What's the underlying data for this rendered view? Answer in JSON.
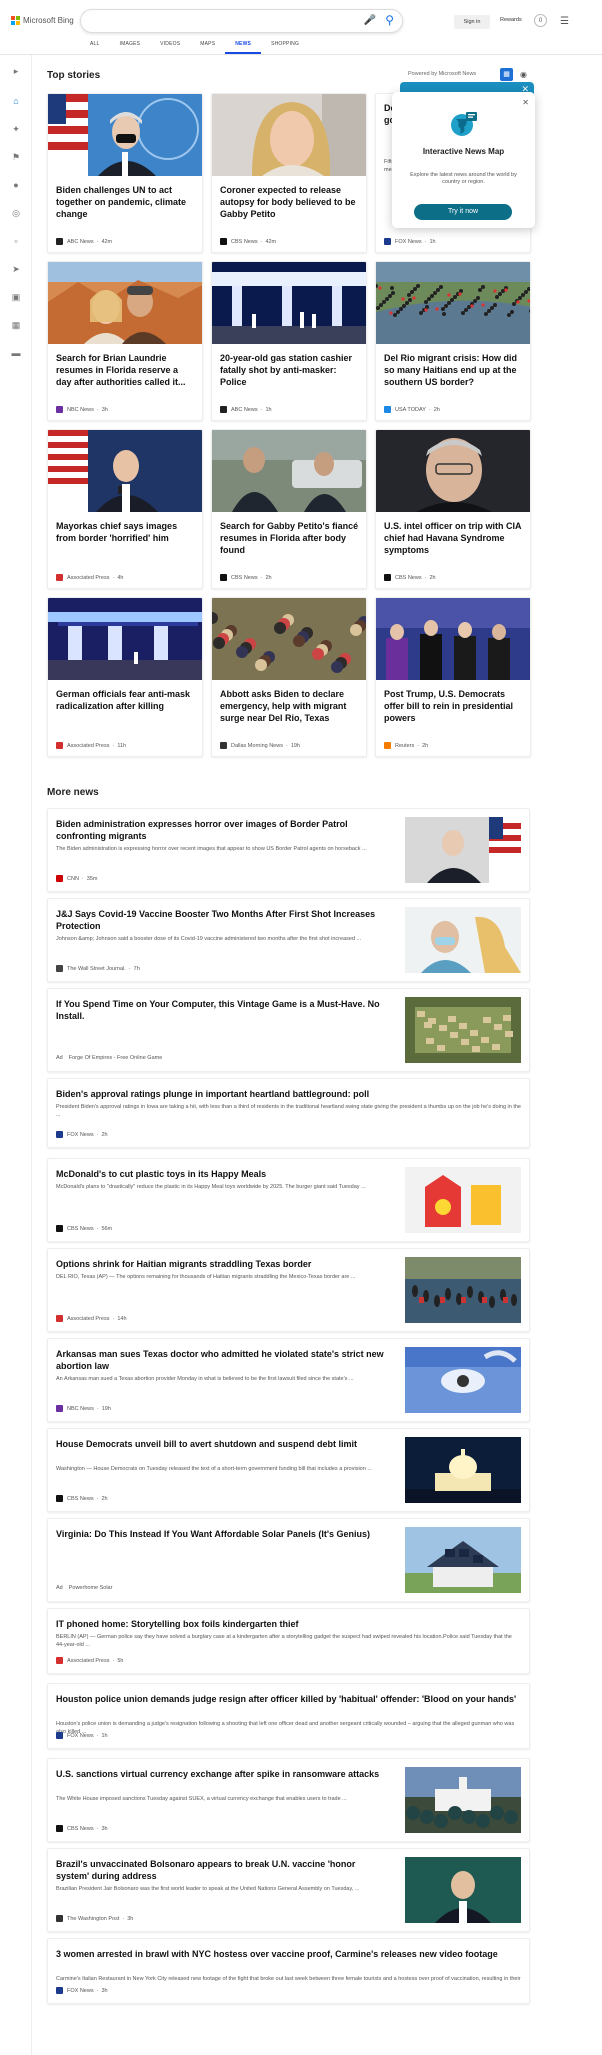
{
  "header": {
    "logo_text": "Microsoft Bing",
    "signin": "Sign in",
    "rewards": "Rewards",
    "rewards_count": "0",
    "tabs": [
      "ALL",
      "IMAGES",
      "VIDEOS",
      "MAPS",
      "NEWS",
      "SHOPPING"
    ],
    "active_tab": "NEWS"
  },
  "top_stories": {
    "title": "Top stories",
    "powered_by": "Powered by Microsoft News",
    "cards": [
      {
        "title": "Biden challenges UN to act together on pandemic, climate change",
        "source": "ABC News",
        "time": "42m",
        "source_color": "#222"
      },
      {
        "title": "Coroner expected to release autopsy for body believed to be Gabby Petito",
        "source": "CBS News",
        "time": "42m",
        "source_color": "#111"
      },
      {
        "title": "Democrats unveil bill to fund government, raise debt limit",
        "source": "FOX News",
        "time": "1h",
        "source_color": "#1b3b8c",
        "desc": "Fifteen House Democrats are circulating a stopgap measure and Biden ... that they ... and the ..."
      },
      {
        "title": "Search for Brian Laundrie resumes in Florida reserve a day after authorities called it...",
        "source": "NBC News",
        "time": "3h",
        "source_color": "#6b2fa0"
      },
      {
        "title": "20-year-old gas station cashier fatally shot by anti-masker: Police",
        "source": "ABC News",
        "time": "1h",
        "source_color": "#222"
      },
      {
        "title": "Del Rio migrant crisis: How did so many Haitians end up at the southern US border?",
        "source": "USA TODAY",
        "time": "2h",
        "source_color": "#1e88e5"
      },
      {
        "title": "Mayorkas chief says images from border 'horrified' him",
        "source": "Associated Press",
        "time": "4h",
        "source_color": "#d32f2f"
      },
      {
        "title": "Search for Gabby Petito's fiancé resumes in Florida after body found",
        "source": "CBS News",
        "time": "2h",
        "source_color": "#111"
      },
      {
        "title": "U.S. intel officer on trip with CIA chief had Havana Syndrome symptoms",
        "source": "CBS News",
        "time": "2h",
        "source_color": "#111"
      },
      {
        "title": "German officials fear anti-mask radicalization after killing",
        "source": "Associated Press",
        "time": "11h",
        "source_color": "#d32f2f"
      },
      {
        "title": "Abbott asks Biden to declare emergency, help with migrant surge near Del Rio, Texas",
        "source": "Dallas Morning News",
        "time": "19h",
        "source_color": "#333"
      },
      {
        "title": "Post Trump, U.S. Democrats offer bill to rein in presidential powers",
        "source": "Reuters",
        "time": "2h",
        "source_color": "#f57c00"
      }
    ]
  },
  "map_popup": {
    "title": "Interactive News Map",
    "desc": "Explore the latest news around the world by country or region.",
    "button": "Try it now"
  },
  "more_news": {
    "title": "More news",
    "items": [
      {
        "title": "Biden administration expresses horror over images of Border Patrol confronting migrants",
        "desc": "The Biden administration is expressing horror over recent images that appear to show US Border Patrol agents on horseback ...",
        "source": "CNN",
        "time": "35m",
        "source_color": "#cc0000",
        "has_thumb": true
      },
      {
        "title": "J&J Says Covid-19 Vaccine Booster Two Months After First Shot Increases Protection",
        "desc": "Johnson &amp; Johnson said a booster dose of its Covid-19 vaccine administered two months after the first shot increased ...",
        "source": "The Wall Street Journal.",
        "time": "7h",
        "source_color": "#444",
        "has_thumb": true
      },
      {
        "title": "If You Spend Time on Your Computer, this Vintage Game is a Must-Have. No Install.",
        "desc": "",
        "source": "Forge Of Empires - Free Online Game",
        "time": "",
        "ad": "Ad",
        "source_color": "",
        "has_thumb": true
      },
      {
        "title": "Biden's approval ratings plunge in important heartland battleground: poll",
        "desc": "President Biden's approval ratings in Iowa are taking a hit, with less than a third of residents in the traditional heartland swing state giving the president a thumbs up on the job he's doing in the ...",
        "source": "FOX News",
        "time": "2h",
        "source_color": "#1b3b8c",
        "has_thumb": false
      },
      {
        "title": "McDonald's to cut plastic toys in its Happy Meals",
        "desc": "McDonald's plans to \"drastically\" reduce the plastic in its Happy Meal toys worldwide by 2025. The burger giant said Tuesday ...",
        "source": "CBS News",
        "time": "56m",
        "source_color": "#111",
        "has_thumb": true
      },
      {
        "title": "Options shrink for Haitian migrants straddling Texas border",
        "desc": "DEL RIO, Texas (AP) — The options remaining for thousands of Haitian migrants straddling the Mexico-Texas border are ...",
        "source": "Associated Press",
        "time": "14h",
        "source_color": "#d32f2f",
        "has_thumb": true
      },
      {
        "title": "Arkansas man sues Texas doctor who admitted he violated state's strict new abortion law",
        "desc": "An Arkansas man sued a Texas abortion provider Monday in what is believed to be the first lawsuit filed since the state's ...",
        "source": "NBC News",
        "time": "19h",
        "source_color": "#6b2fa0",
        "has_thumb": true
      },
      {
        "title": "House Democrats unveil bill to avert shutdown and suspend debt limit",
        "desc": "Washington — House Democrats on Tuesday released the text of a short-term government funding bill that includes a provision ...",
        "source": "CBS News",
        "time": "2h",
        "source_color": "#111",
        "has_thumb": true
      },
      {
        "title": "Virginia: Do This Instead If You Want Affordable Solar Panels (It's Genius)",
        "desc": "",
        "source": "Powerhome Solar",
        "time": "",
        "ad": "Ad",
        "source_color": "",
        "has_thumb": true
      },
      {
        "title": "IT phoned home: Storytelling box foils kindergarten thief",
        "desc": "BERLIN (AP) — German police say they have solved a burglary case at a kindergarten after a storytelling gadget the suspect had swiped revealed his location.Police said Tuesday that the 44-year-old ...",
        "source": "Associated Press",
        "time": "5h",
        "source_color": "#d32f2f",
        "has_thumb": false
      },
      {
        "title": "Houston police union demands judge resign after officer killed by 'habitual' offender: 'Blood on your hands'",
        "desc": "Houston's police union is demanding a judge's resignation following a shooting that left one officer dead and another sergeant critically wounded – arguing that the alleged gunman who was also killed ...",
        "source": "FOX News",
        "time": "1h",
        "source_color": "#1b3b8c",
        "has_thumb": false
      },
      {
        "title": "U.S. sanctions virtual currency exchange after spike in ransomware attacks",
        "desc": "The White House imposed sanctions Tuesday against SUEX, a virtual currency exchange that enables users to trade ...",
        "source": "CBS News",
        "time": "3h",
        "source_color": "#111",
        "has_thumb": true
      },
      {
        "title": "Brazil's unvaccinated Bolsonaro appears to break U.N. vaccine 'honor system' during address",
        "desc": "Brazilian President Jair Bolsonaro was the first world leader to speak at the United Nations General Assembly on Tuesday, ...",
        "source": "The Washington Post",
        "time": "3h",
        "source_color": "#333",
        "has_thumb": true
      },
      {
        "title": "3 women arrested in brawl with NYC hostess over vaccine proof, Carmine's releases new video footage",
        "desc": "Carmine's Italian Restaurant in New York City released new footage of the fight that broke out last week between three female tourists and a hostess over proof of vaccination, resulting in their ...",
        "source": "FOX News",
        "time": "3h",
        "source_color": "#1b3b8c",
        "has_thumb": false
      }
    ]
  }
}
